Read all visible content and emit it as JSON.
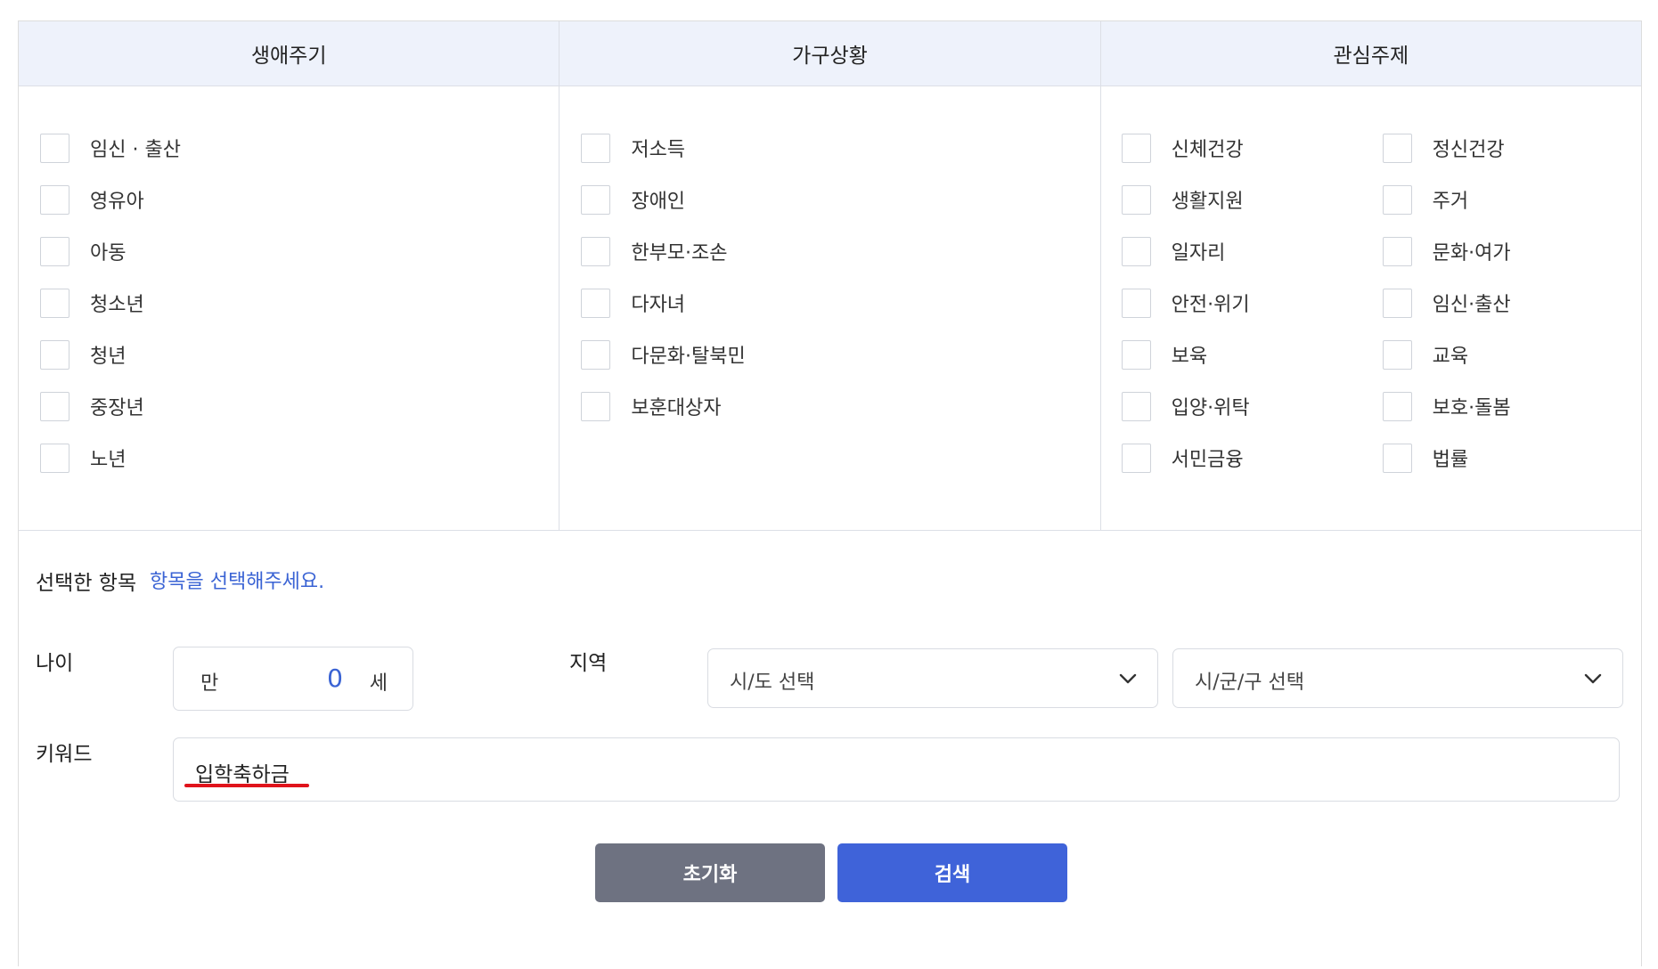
{
  "headers": [
    "생애주기",
    "가구상황",
    "관심주제"
  ],
  "life_cycle": [
    "임신 · 출산",
    "영유아",
    "아동",
    "청소년",
    "청년",
    "중장년",
    "노년"
  ],
  "household": [
    "저소득",
    "장애인",
    "한부모·조손",
    "다자녀",
    "다문화·탈북민",
    "보훈대상자"
  ],
  "interests": [
    "신체건강",
    "정신건강",
    "생활지원",
    "주거",
    "일자리",
    "문화·여가",
    "안전·위기",
    "임신·출산",
    "보육",
    "교육",
    "입양·위탁",
    "보호·돌봄",
    "서민금융",
    "법률"
  ],
  "selected": {
    "label": "선택한 항목",
    "hint": "항목을 선택해주세요."
  },
  "age": {
    "label": "나이",
    "prefix": "만",
    "value": "0",
    "suffix": "세"
  },
  "region": {
    "label": "지역",
    "sido": "시/도 선택",
    "sigungu": "시/군/구 선택"
  },
  "keyword": {
    "label": "키워드",
    "value": "입학축하금"
  },
  "buttons": {
    "reset": "초기화",
    "search": "검색"
  },
  "colors": {
    "accent": "#3f63d9",
    "hint": "#3a63d4",
    "reset": "#6e7281",
    "underline": "#e0131b",
    "header_bg": "#eef2fb"
  }
}
